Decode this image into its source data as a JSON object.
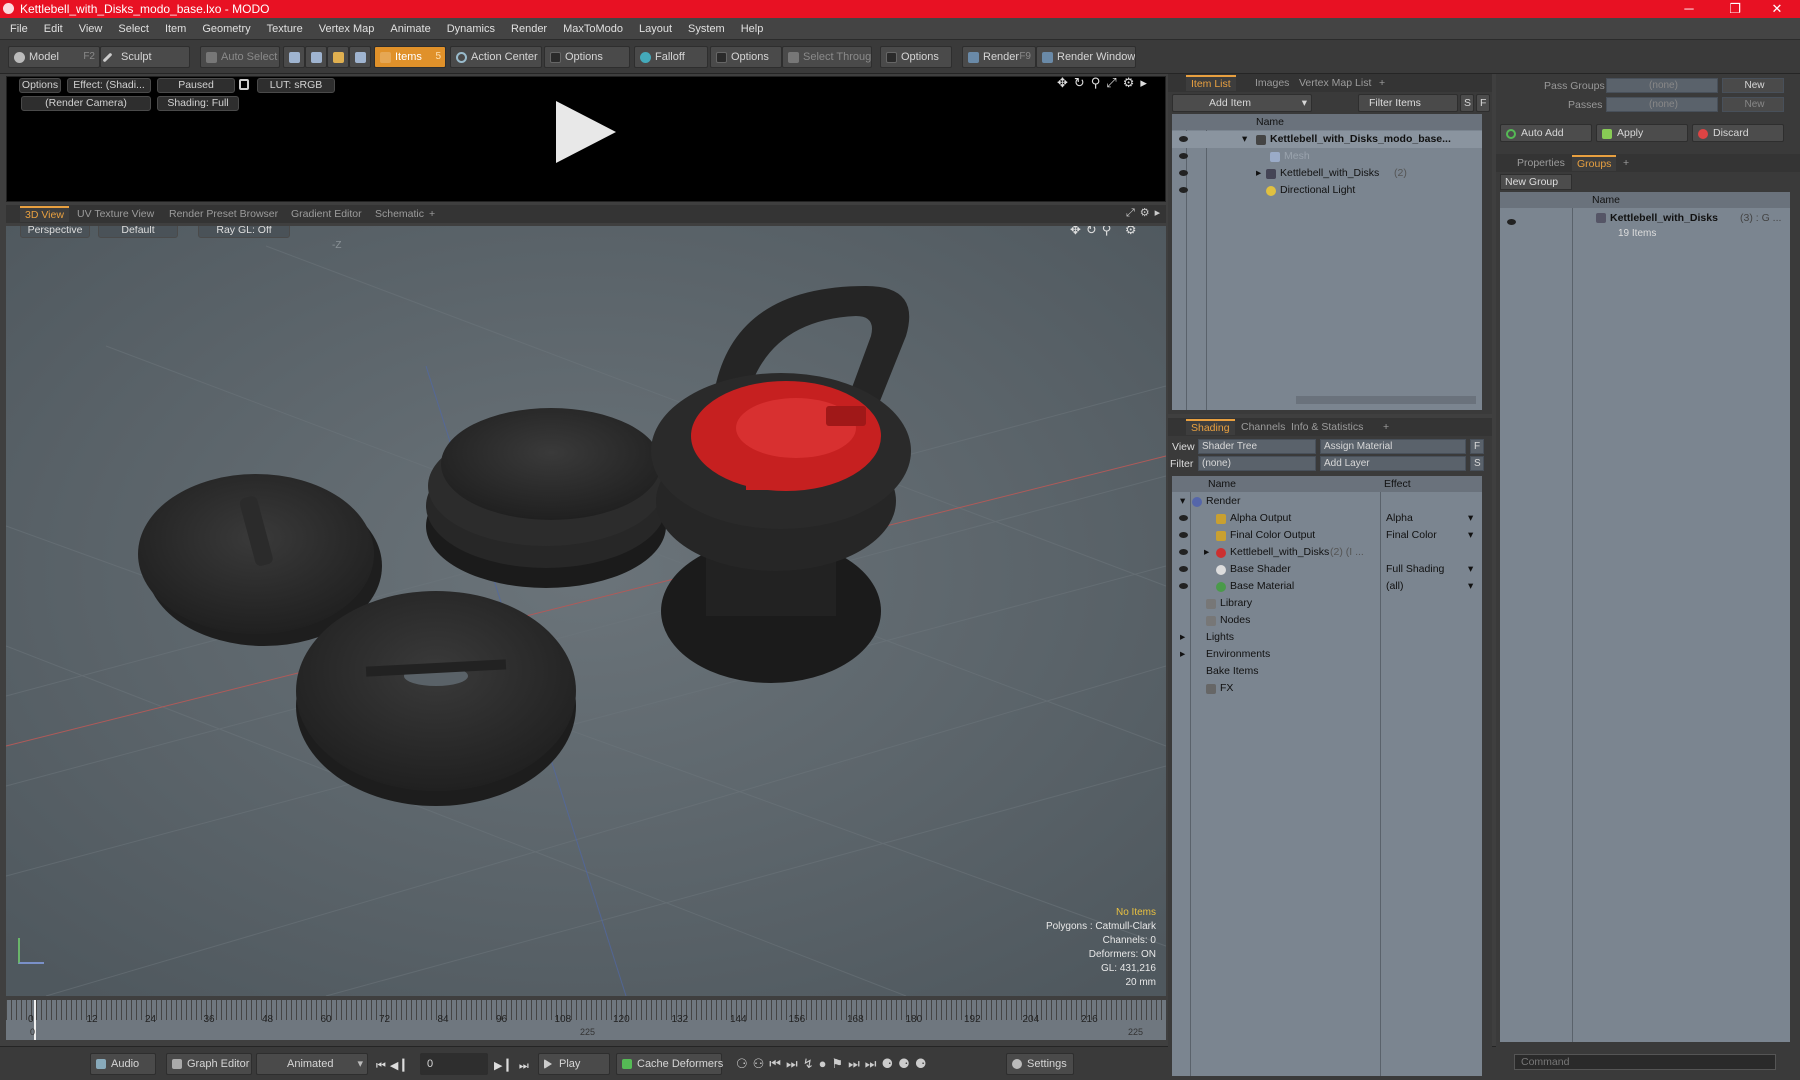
{
  "window": {
    "title": "Kettlebell_with_Disks_modo_base.lxo - MODO",
    "minimize": "─",
    "maximize": "❐",
    "close": "✕"
  },
  "menu": [
    "File",
    "Edit",
    "View",
    "Select",
    "Item",
    "Geometry",
    "Texture",
    "Vertex Map",
    "Animate",
    "Dynamics",
    "Render",
    "MaxToModo",
    "Layout",
    "System",
    "Help"
  ],
  "toolbar": {
    "model": "Model",
    "model_key": "F2",
    "sculpt": "Sculpt",
    "auto_select": "Auto Select",
    "items": "Items",
    "items_key": "5",
    "action_center": "Action Center",
    "options1": "Options",
    "falloff": "Falloff",
    "options2": "Options",
    "select_through": "Select Through",
    "options3": "Options",
    "render": "Render",
    "render_key": "F9",
    "render_window": "Render Window"
  },
  "preview": {
    "options": "Options",
    "effect": "Effect: (Shadi...",
    "paused": "Paused",
    "lut": "LUT: sRGB",
    "camera": "(Render Camera)",
    "shading": "Shading: Full"
  },
  "view_tabs": [
    "3D View",
    "UV Texture View",
    "Render Preset Browser",
    "Gradient Editor",
    "Schematic",
    "+"
  ],
  "viewport": {
    "perspective": "Perspective",
    "default": "Default",
    "raygl": "Ray GL: Off",
    "axis_label": "-Z",
    "info": [
      "No Items",
      "Polygons : Catmull-Clark",
      "Channels: 0",
      "Deformers: ON",
      "GL: 431,216",
      "20 mm"
    ]
  },
  "timeline": {
    "ticks": [
      "0",
      "12",
      "24",
      "36",
      "48",
      "60",
      "72",
      "84",
      "96",
      "108",
      "120",
      "132",
      "144",
      "156",
      "168",
      "180",
      "192",
      "204",
      "216"
    ],
    "start": "0",
    "mid": "225",
    "end": "225"
  },
  "bottom": {
    "audio": "Audio",
    "graph_editor": "Graph Editor",
    "animated": "Animated",
    "frame": "0",
    "play": "Play",
    "cache": "Cache Deformers",
    "settings": "Settings"
  },
  "itemlist": {
    "tabs": [
      "Item List",
      "Images",
      "Vertex Map List",
      "+"
    ],
    "add_item": "Add Item",
    "filter": "Filter Items",
    "s": "S",
    "f": "F",
    "col_name": "Name",
    "rows": [
      {
        "label": "Kettlebell_with_Disks_modo_base...",
        "extra": ""
      },
      {
        "label": "Mesh",
        "extra": ""
      },
      {
        "label": "Kettlebell_with_Disks",
        "extra": "(2)"
      },
      {
        "label": "Directional Light",
        "extra": ""
      }
    ]
  },
  "shading": {
    "tabs": [
      "Shading",
      "Channels",
      "Info & Statistics",
      "+"
    ],
    "view_label": "View",
    "view_value": "Shader Tree",
    "assign": "Assign Material",
    "f": "F",
    "filter_label": "Filter",
    "filter_value": "(none)",
    "add_layer": "Add Layer",
    "s": "S",
    "col_name": "Name",
    "col_effect": "Effect",
    "rows": [
      {
        "label": "Render",
        "effect": ""
      },
      {
        "label": "Alpha Output",
        "effect": "Alpha"
      },
      {
        "label": "Final Color Output",
        "effect": "Final Color"
      },
      {
        "label": "Kettlebell_with_Disks",
        "extra": "(2) (I ...",
        "effect": ""
      },
      {
        "label": "Base Shader",
        "effect": "Full Shading"
      },
      {
        "label": "Base Material",
        "effect": "(all)"
      },
      {
        "label": "Library",
        "effect": ""
      },
      {
        "label": "Nodes",
        "effect": ""
      },
      {
        "label": "Lights",
        "effect": ""
      },
      {
        "label": "Environments",
        "effect": ""
      },
      {
        "label": "Bake Items",
        "effect": ""
      },
      {
        "label": "FX",
        "effect": ""
      }
    ]
  },
  "groups": {
    "pass_groups": "Pass Groups",
    "pass_value": "(none)",
    "new1": "New",
    "passes": "Passes",
    "passes_value": "(none)",
    "new2": "New",
    "auto_add": "Auto Add",
    "apply": "Apply",
    "discard": "Discard",
    "tabs": [
      "Properties",
      "Groups",
      "+"
    ],
    "new_group": "New Group",
    "col_name": "Name",
    "group_name": "Kettlebell_with_Disks",
    "group_extra": "(3) : G ...",
    "group_count": "19 Items"
  },
  "command": {
    "placeholder": "Command"
  }
}
